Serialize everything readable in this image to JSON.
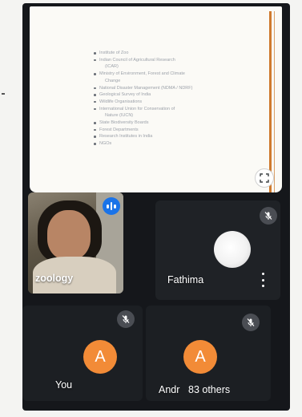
{
  "slide": {
    "bullets": [
      {
        "text": "Institute of Zoo",
        "cont": false
      },
      {
        "text": "Indian Council of Agricultural Research",
        "cont": false
      },
      {
        "text": "(ICAR)",
        "cont": true
      },
      {
        "text": "Ministry of Environment, Forest and Climate",
        "cont": false
      },
      {
        "text": "Change",
        "cont": true
      },
      {
        "text": "National Disaster Management (NDMA / NDRF)",
        "cont": false
      },
      {
        "text": "Geological Survey of India",
        "cont": false
      },
      {
        "text": "Wildlife Organisations",
        "cont": false
      },
      {
        "text": "International Union for Conservation of",
        "cont": false
      },
      {
        "text": "Nature (IUCN)",
        "cont": true
      },
      {
        "text": "State Biodiversity Boards",
        "cont": false
      },
      {
        "text": "Forest Departments",
        "cont": false
      },
      {
        "text": "Research Institutes in India",
        "cont": false
      },
      {
        "text": "NGOs",
        "cont": false
      }
    ]
  },
  "participants": {
    "zoology": {
      "name": "zoology"
    },
    "fathima": {
      "name": "Fathima"
    },
    "you": {
      "name": "You",
      "initial": "A"
    },
    "andr": {
      "name": "Andr",
      "initial": "A",
      "others": "83 others"
    }
  },
  "colors": {
    "speaking": "#1a73e8",
    "avatar": "#f28b37",
    "accent_line": "#cf7a2e"
  },
  "icons": {
    "fullscreen": "fullscreen-icon",
    "speaking": "speaking-indicator-icon",
    "mic_off": "mic-off-icon",
    "more": "more-vert-icon"
  }
}
